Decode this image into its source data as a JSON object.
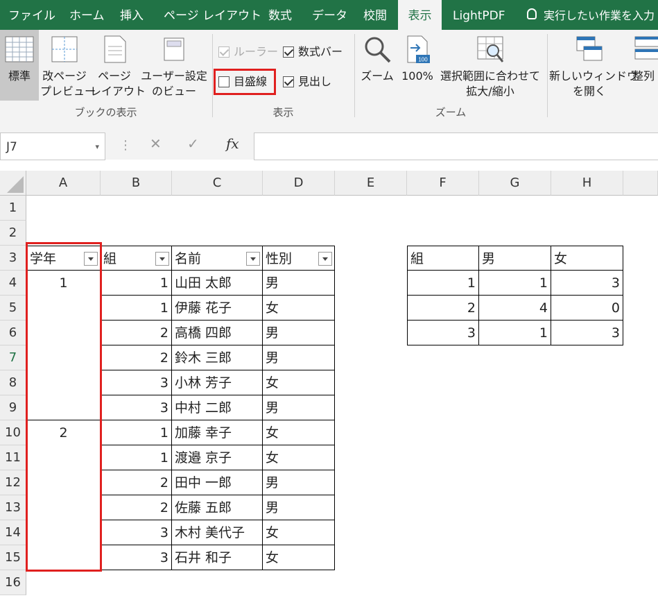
{
  "tabs": [
    "ファイル",
    "ホーム",
    "挿入",
    "ページ レイアウト",
    "数式",
    "データ",
    "校閲",
    "表示",
    "LightPDF"
  ],
  "active_tab": "表示",
  "tell_me": "実行したい作業を入力",
  "ribbon": {
    "workbook_views": {
      "label": "ブックの表示",
      "normal": "標準",
      "page_break_1": "改ページ",
      "page_break_2": "プレビュー",
      "page_layout_1": "ページ",
      "page_layout_2": "レイアウト",
      "custom_1": "ユーザー設定",
      "custom_2": "のビュー"
    },
    "show": {
      "label": "表示",
      "ruler": "ルーラー",
      "formula_bar": "数式バー",
      "gridlines": "目盛線",
      "headings": "見出し",
      "ruler_checked": true,
      "formula_bar_checked": true,
      "gridlines_checked": false,
      "headings_checked": true
    },
    "zoom": {
      "label": "ズーム",
      "zoom": "ズーム",
      "hundred": "100%",
      "fit_1": "選択範囲に合わせて",
      "fit_2": "拡大/縮小",
      "badge": "100"
    },
    "window": {
      "new_1": "新しいウィンドウ",
      "new_2": "を開く",
      "arrange": "整列"
    }
  },
  "name_box": "J7",
  "fx": "fx",
  "columns": [
    "A",
    "B",
    "C",
    "D",
    "E",
    "F",
    "G",
    "H"
  ],
  "rows": [
    "1",
    "2",
    "3",
    "4",
    "5",
    "6",
    "7",
    "8",
    "9",
    "10",
    "11",
    "12",
    "13",
    "14",
    "15",
    "16"
  ],
  "selected_row": "7",
  "table1": {
    "headers": [
      "学年",
      "組",
      "名前",
      "性別"
    ],
    "rows": [
      {
        "grade": "1",
        "class": "1",
        "name": "山田 太郎",
        "gender": "男"
      },
      {
        "grade": "",
        "class": "1",
        "name": "伊藤 花子",
        "gender": "女"
      },
      {
        "grade": "",
        "class": "2",
        "name": "高橋 四郎",
        "gender": "男"
      },
      {
        "grade": "",
        "class": "2",
        "name": "鈴木 三郎",
        "gender": "男"
      },
      {
        "grade": "",
        "class": "3",
        "name": "小林 芳子",
        "gender": "女"
      },
      {
        "grade": "",
        "class": "3",
        "name": "中村 二郎",
        "gender": "男"
      },
      {
        "grade": "2",
        "class": "1",
        "name": "加藤 幸子",
        "gender": "女"
      },
      {
        "grade": "",
        "class": "1",
        "name": "渡邉 京子",
        "gender": "女"
      },
      {
        "grade": "",
        "class": "2",
        "name": "田中 一郎",
        "gender": "男"
      },
      {
        "grade": "",
        "class": "2",
        "name": "佐藤 五郎",
        "gender": "男"
      },
      {
        "grade": "",
        "class": "3",
        "name": "木村 美代子",
        "gender": "女"
      },
      {
        "grade": "",
        "class": "3",
        "name": "石井 和子",
        "gender": "女"
      }
    ]
  },
  "table2": {
    "headers": [
      "組",
      "男",
      "女"
    ],
    "rows": [
      [
        "1",
        "1",
        "3"
      ],
      [
        "2",
        "4",
        "0"
      ],
      [
        "3",
        "1",
        "3"
      ]
    ]
  }
}
